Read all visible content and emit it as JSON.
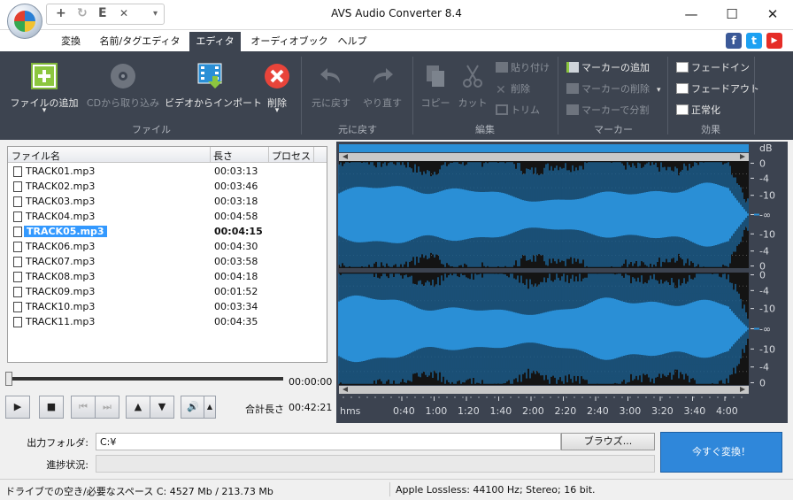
{
  "titlebar": {
    "title": "AVS Audio Converter  8.4"
  },
  "quick_access": {
    "add": "+",
    "reload": "↻",
    "export": "E",
    "close": "✕",
    "more": "▾"
  },
  "window_controls": {
    "minimize": "—",
    "maximize": "☐",
    "close": "✕"
  },
  "menu": {
    "tabs": [
      "変換",
      "名前/タグエディタ",
      "エディタ",
      "オーディオブック",
      "ヘルプ"
    ],
    "active": "エディタ"
  },
  "social": {
    "facebook": "f",
    "twitter": "t",
    "youtube": "▶"
  },
  "ribbon": {
    "file": {
      "add_file": "ファイルの追加",
      "from_cd": "CDから取り込み",
      "import_video": "ビデオからインポート",
      "delete": "削除",
      "group": "ファイル"
    },
    "undo": {
      "undo": "元に戻す",
      "redo": "やり直す",
      "group": "元に戻す"
    },
    "edit": {
      "copy": "コピー",
      "cut": "カット",
      "paste": "貼り付け",
      "delete": "削除",
      "trim": "トリム",
      "group": "編集"
    },
    "marker": {
      "add": "マーカーの追加",
      "remove": "マーカーの削除",
      "split": "マーカーで分割",
      "group": "マーカー"
    },
    "effects": {
      "fade_in": "フェードイン",
      "fade_out": "フェードアウト",
      "normalize": "正常化",
      "group": "効果"
    }
  },
  "filelist": {
    "columns": [
      "ファイル名",
      "長さ",
      "プロセス"
    ],
    "rows": [
      {
        "name": "TRACK01.mp3",
        "length": "00:03:13",
        "selected": false
      },
      {
        "name": "TRACK02.mp3",
        "length": "00:03:46",
        "selected": false
      },
      {
        "name": "TRACK03.mp3",
        "length": "00:03:18",
        "selected": false
      },
      {
        "name": "TRACK04.mp3",
        "length": "00:04:58",
        "selected": false
      },
      {
        "name": "TRACK05.mp3",
        "length": "00:04:15",
        "selected": true
      },
      {
        "name": "TRACK06.mp3",
        "length": "00:04:30",
        "selected": false
      },
      {
        "name": "TRACK07.mp3",
        "length": "00:03:58",
        "selected": false
      },
      {
        "name": "TRACK08.mp3",
        "length": "00:04:18",
        "selected": false
      },
      {
        "name": "TRACK09.mp3",
        "length": "00:01:52",
        "selected": false
      },
      {
        "name": "TRACK10.mp3",
        "length": "00:03:34",
        "selected": false
      },
      {
        "name": "TRACK11.mp3",
        "length": "00:04:35",
        "selected": false
      }
    ]
  },
  "player": {
    "time": "00:00:00",
    "total_label": "合計長さ",
    "total_value": "00:42:21",
    "play": "▶",
    "stop": "■",
    "prev": "⏮",
    "next": "⏭",
    "up": "▲",
    "down": "▼",
    "volume": "🔊",
    "volume_menu": "▲"
  },
  "waveform": {
    "db_header": "dB",
    "db_labels_top": [
      "0",
      "-4",
      "-10",
      "-∞",
      "-10",
      "-4",
      "0"
    ],
    "db_labels_bottom": [
      "0",
      "-4",
      "-10",
      "-∞",
      "-10",
      "-4",
      "0"
    ],
    "time_unit": "hms",
    "time_labels": [
      "0:40",
      "1:00",
      "1:20",
      "1:40",
      "2:00",
      "2:20",
      "2:40",
      "3:00",
      "3:20",
      "3:40",
      "4:00"
    ],
    "wave_color": "#2a8fd6",
    "background_color": "#141414"
  },
  "output": {
    "folder_label": "出力フォルダ:",
    "folder_value": "C:¥",
    "browse_label": "ブラウズ...",
    "progress_label": "進捗状況:",
    "convert_label": "今すぐ変換！"
  },
  "status": {
    "disk_space": "ドライブでの空き/必要なスペース C: 4527 Mb / 213.73 Mb",
    "format": "Apple Lossless:  44100  Hz; Stereo;  16 bit."
  }
}
